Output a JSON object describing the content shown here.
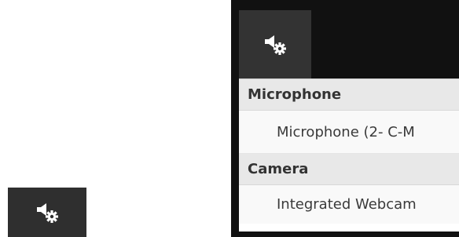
{
  "icons": {
    "standalone_button": "speaker-settings-icon",
    "toolbar_button": "speaker-settings-icon"
  },
  "colors": {
    "button_bg": "#2f2f2f",
    "panel_bg": "#111111",
    "header_bg": "#e8e8e8",
    "item_bg": "#f9f9f9",
    "text": "#333333"
  },
  "device_menu": {
    "sections": [
      {
        "header": "Microphone",
        "items": [
          "Microphone (2- C-M"
        ]
      },
      {
        "header": "Camera",
        "items": [
          "Integrated Webcam"
        ]
      }
    ]
  }
}
